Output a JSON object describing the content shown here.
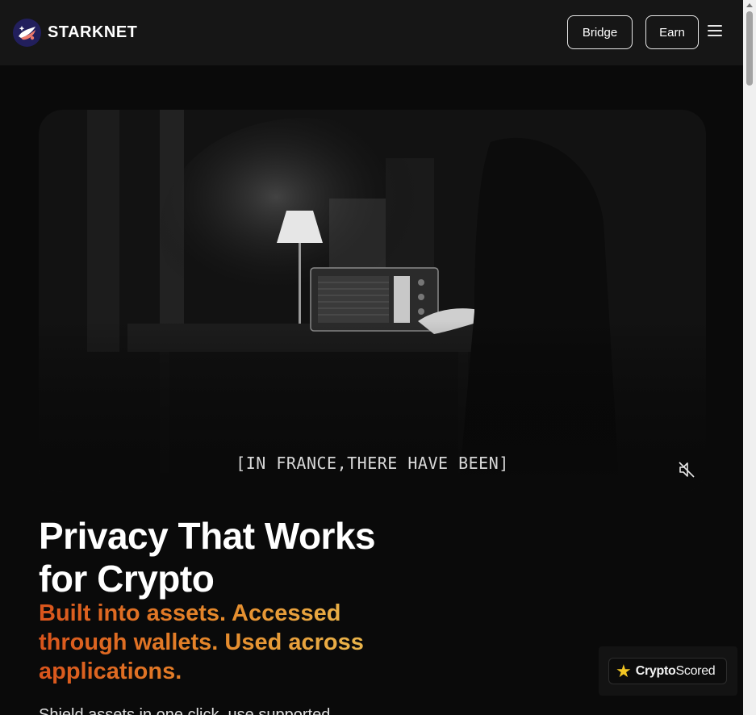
{
  "header": {
    "logo_text": "STARKNET",
    "bridge_label": "Bridge",
    "earn_label": "Earn",
    "menu_icon": "hamburger-menu-icon"
  },
  "hero": {
    "caption": "[IN FRANCE,THERE HAVE BEEN]",
    "mute_icon": "speaker-muted-icon"
  },
  "main": {
    "headline_line1": "Privacy That Works",
    "headline_line2": "for Crypto",
    "subheadline_line1": "Built into assets. Accessed",
    "subheadline_line2": "through wallets. Used across",
    "subheadline_line3": "applications.",
    "body_text": "Shield assets in one click, use supported"
  },
  "badge": {
    "star_icon": "star-icon",
    "brand_bold": "Crypto",
    "brand_light": "Scored"
  },
  "colors": {
    "accent_gradient_start": "#d9541c",
    "accent_gradient_end": "#eab44a",
    "background": "#0a0a0a",
    "header_bg": "#161616"
  }
}
